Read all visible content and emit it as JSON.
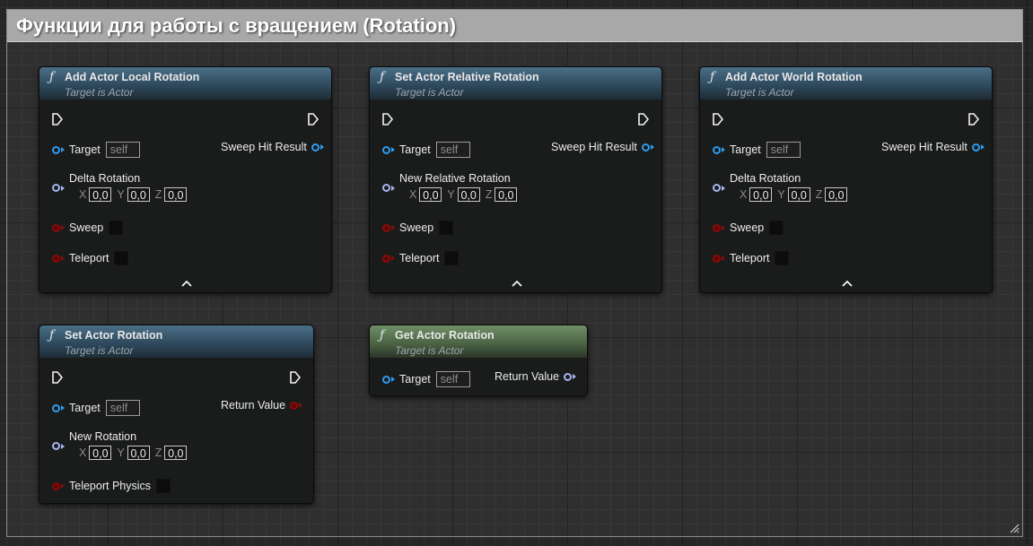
{
  "comment": {
    "title": "Функции для работы с вращением (Rotation)"
  },
  "labels": {
    "target": "Target",
    "self": "self",
    "axis_x": "X",
    "axis_y": "Y",
    "axis_z": "Z",
    "vector_value": "0,0"
  },
  "nodes": {
    "add_local": {
      "title": "Add Actor Local Rotation",
      "subtitle": "Target is Actor",
      "output": "Sweep Hit Result",
      "vector": "Delta Rotation",
      "bool1": "Sweep",
      "bool2": "Teleport"
    },
    "set_relative": {
      "title": "Set Actor Relative Rotation",
      "subtitle": "Target is Actor",
      "output": "Sweep Hit Result",
      "vector": "New Relative Rotation",
      "bool1": "Sweep",
      "bool2": "Teleport"
    },
    "add_world": {
      "title": "Add Actor World Rotation",
      "subtitle": "Target is Actor",
      "output": "Sweep Hit Result",
      "vector": "Delta Rotation",
      "bool1": "Sweep",
      "bool2": "Teleport"
    },
    "set_rotation": {
      "title": "Set Actor Rotation",
      "subtitle": "Target is Actor",
      "output": "Return Value",
      "vector": "New Rotation",
      "bool1": "Teleport Physics"
    },
    "get_rotation": {
      "title": "Get Actor Rotation",
      "subtitle": "Target is Actor",
      "output": "Return Value"
    }
  },
  "colors": {
    "object_pin": "#2f9cf0",
    "struct_pin": "#a6b6f0",
    "bool_pin": "#8c0a0a",
    "impure_header": "#3b5a70",
    "pure_header": "#5d7a55"
  },
  "icons": {
    "function": "function-icon",
    "exec": "exec-pin-icon",
    "collapse": "chevron-up-icon"
  }
}
